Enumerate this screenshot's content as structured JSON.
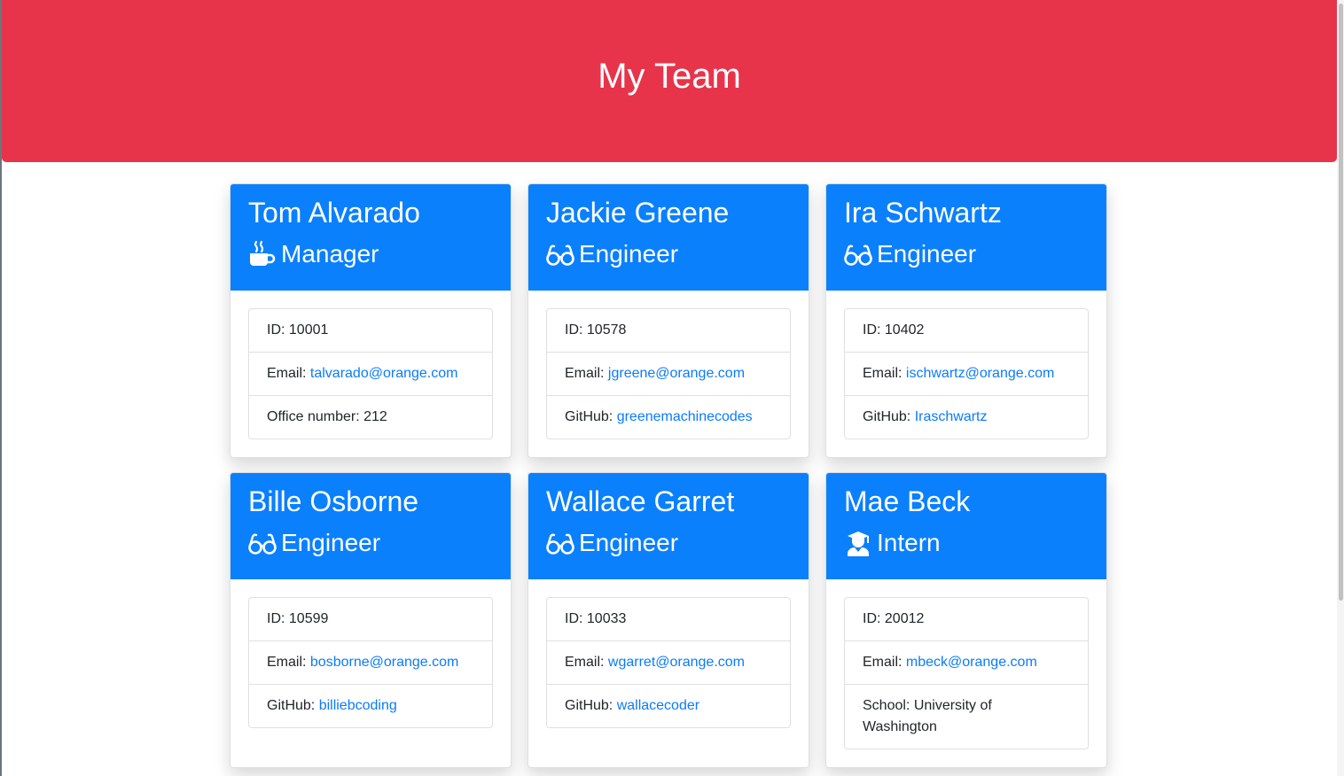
{
  "page": {
    "title": "My Team"
  },
  "cards": [
    {
      "name": "Tom Alvarado",
      "role": "Manager",
      "role_icon": "coffee-icon",
      "id_label": "ID: ",
      "id": "10001",
      "email_label": "Email: ",
      "email": "talvarado@orange.com",
      "extra_label": "Office number: ",
      "extra": "212",
      "extra_is_link": false
    },
    {
      "name": "Jackie Greene",
      "role": "Engineer",
      "role_icon": "glasses-icon",
      "id_label": "ID: ",
      "id": "10578",
      "email_label": "Email: ",
      "email": "jgreene@orange.com",
      "extra_label": "GitHub: ",
      "extra": "greenemachinecodes",
      "extra_is_link": true
    },
    {
      "name": "Ira Schwartz",
      "role": "Engineer",
      "role_icon": "glasses-icon",
      "id_label": "ID: ",
      "id": "10402",
      "email_label": "Email: ",
      "email": "ischwartz@orange.com",
      "extra_label": "GitHub: ",
      "extra": "Iraschwartz",
      "extra_is_link": true
    },
    {
      "name": "Bille Osborne",
      "role": "Engineer",
      "role_icon": "glasses-icon",
      "id_label": "ID: ",
      "id": "10599",
      "email_label": "Email: ",
      "email": "bosborne@orange.com",
      "extra_label": "GitHub: ",
      "extra": "billiebcoding",
      "extra_is_link": true
    },
    {
      "name": "Wallace Garret",
      "role": "Engineer",
      "role_icon": "glasses-icon",
      "id_label": "ID: ",
      "id": "10033",
      "email_label": "Email: ",
      "email": "wgarret@orange.com",
      "extra_label": "GitHub: ",
      "extra": "wallacecoder",
      "extra_is_link": true
    },
    {
      "name": "Mae Beck",
      "role": "Intern",
      "role_icon": "graduate-icon",
      "id_label": "ID: ",
      "id": "20012",
      "email_label": "Email: ",
      "email": "mbeck@orange.com",
      "extra_label": "School: ",
      "extra": "University of Washington",
      "extra_is_link": false
    }
  ],
  "colors": {
    "header_bg": "#e7344b",
    "card_header_bg": "#0a80fd",
    "link": "#0a7bff"
  }
}
